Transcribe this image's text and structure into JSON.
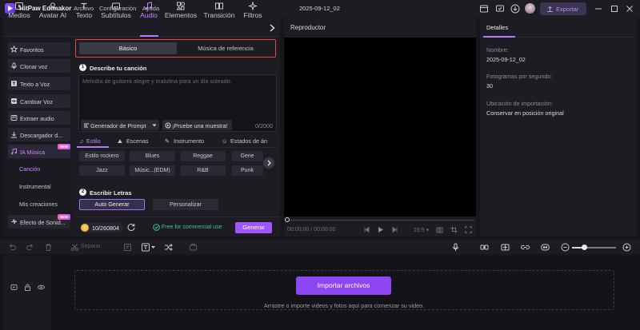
{
  "app": {
    "name": "HitPaw Edimakor",
    "menu": [
      "Archivo",
      "Configuración",
      "Ayuda"
    ],
    "doc_title": "2025-09-12_02",
    "export_label": "Exportar"
  },
  "tabs": [
    {
      "label": "Medios",
      "icon": "media-icon"
    },
    {
      "label": "Avatar AI",
      "icon": "avatar-icon"
    },
    {
      "label": "Texto",
      "icon": "text-icon"
    },
    {
      "label": "Subtítulos",
      "icon": "subtitles-icon"
    },
    {
      "label": "Audio",
      "icon": "music-note-icon",
      "active": true
    },
    {
      "label": "Elementos",
      "icon": "elements-icon"
    },
    {
      "label": "Transición",
      "icon": "transition-icon"
    },
    {
      "label": "Filtros",
      "icon": "filters-icon"
    }
  ],
  "sidebar": {
    "items": [
      {
        "label": "Favoritos",
        "icon": "star-icon"
      },
      {
        "label": "Clonar voz",
        "icon": "mic-icon"
      },
      {
        "label": "Texto a Voz",
        "icon": "text-to-speech-icon"
      },
      {
        "label": "Cambiar Voz",
        "icon": "voice-change-icon"
      },
      {
        "label": "Extraer audio",
        "icon": "extract-audio-icon"
      },
      {
        "label": "Descargador d...",
        "icon": "download-icon"
      },
      {
        "label": "IA Música",
        "icon": "ai-music-icon",
        "active": true,
        "badge": "NEW"
      },
      {
        "label": "Efecto de Sonid...",
        "icon": "sound-effect-icon",
        "badge": "NEW"
      }
    ],
    "sub_items": [
      "Canción",
      "Instrumental",
      "Mis creaciones"
    ],
    "active_sub": "Canción"
  },
  "music": {
    "segments": [
      "Básico",
      "Música de referencia"
    ],
    "step1_title": "Describe tu canción",
    "prompt_placeholder": "Melodía de guitarra alegre y matutina para un día soleado.",
    "gen_prompt_label": "Generador de Prompt",
    "sample_label": "¡Pruebe una muestra!",
    "char_count": "0/2000",
    "style_tabs": [
      "Estilo",
      "Escenas",
      "Instrumento",
      "Estados de án"
    ],
    "chips": [
      [
        "Estilo rockero",
        "Blues",
        "Reggae",
        "Gene"
      ],
      [
        "Jazz",
        "Músic...(EDM)",
        "R&B",
        "Punk"
      ]
    ],
    "step2_title": "Escribir Letras",
    "lyrics_options": [
      "Auto Generar",
      "Personalizar"
    ],
    "credits": "10/260804",
    "free_text": "Free for commercial use",
    "generate_label": "Generar"
  },
  "player": {
    "title": "Reproductor",
    "timecode": "00:00:00 / 00:00:00",
    "ratio": "16:9",
    "progress": 0
  },
  "details": {
    "tab": "Detalles",
    "fields": [
      {
        "label": "Nombre:",
        "value": "2025-09-12_02"
      },
      {
        "label": "Fotogramas por segundo:",
        "value": "30"
      },
      {
        "label": "Ubicación de importación:",
        "value": "Conservar en posición original"
      }
    ]
  },
  "timeline": {
    "split_label": "Separar",
    "import_label": "Importar archivos",
    "drop_hint": "Arrastre o importe videos y fotos aquí para comenzar su video.",
    "zoom_level": 0.3
  },
  "colors": {
    "accent": "#a055ff",
    "active_text": "#c58cff",
    "highlight_border": "#e04848",
    "free_green": "#3fc88f"
  }
}
